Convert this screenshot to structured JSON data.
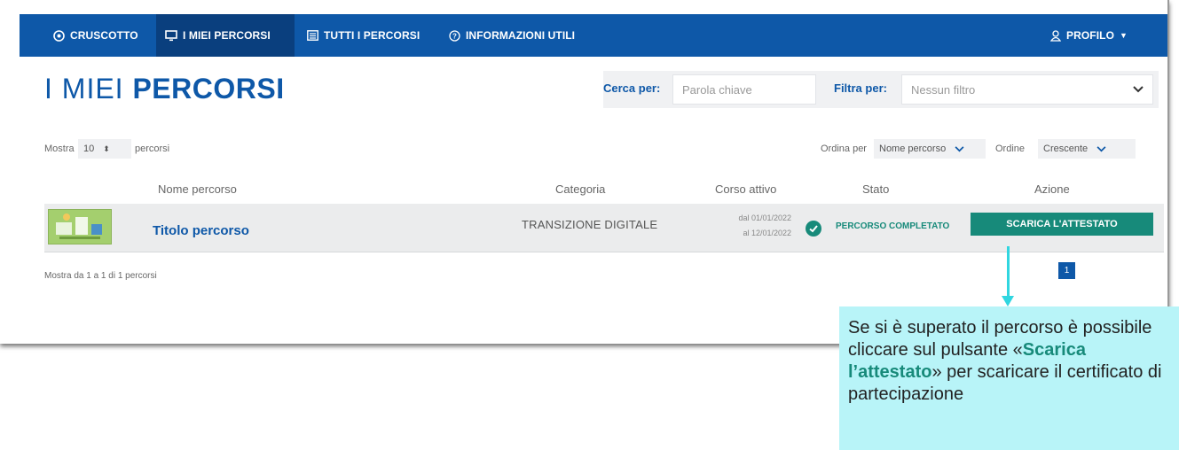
{
  "nav": {
    "items": [
      {
        "label": "CRUSCOTTO",
        "icon": "dashboard-icon"
      },
      {
        "label": "I MIEI PERCORSI",
        "icon": "monitor-icon"
      },
      {
        "label": "TUTTI I PERCORSI",
        "icon": "list-icon"
      },
      {
        "label": "INFORMAZIONI UTILI",
        "icon": "help-icon"
      }
    ],
    "profile": "PROFILO"
  },
  "page": {
    "title_light": "I MIEI ",
    "title_bold": "PERCORSI"
  },
  "search": {
    "label": "Cerca per:",
    "placeholder": "Parola chiave",
    "filter_label": "Filtra per:",
    "filter_value": "Nessun filtro"
  },
  "list_controls": {
    "show_prefix": "Mostra",
    "page_size": "10",
    "show_suffix": "percorsi",
    "sort_label": "Ordina per",
    "sort_value": "Nome percorso",
    "order_label": "Ordine",
    "order_value": "Crescente"
  },
  "table": {
    "headers": [
      "Nome percorso",
      "Categoria",
      "Corso attivo",
      "Stato",
      "Azione"
    ],
    "rows": [
      {
        "title": "Titolo percorso",
        "category": "TRANSIZIONE DIGITALE",
        "date_from": "dal 01/01/2022",
        "date_to": "al 12/01/2022",
        "status": "PERCORSO COMPLETATO",
        "action": "SCARICA L'ATTESTATO"
      }
    ]
  },
  "pagination": {
    "summary": "Mostra da 1 a 1 di 1 percorsi",
    "current_page": "1"
  },
  "callout": {
    "line1": "Se si è superato il percorso è possibile cliccare sul pulsante «",
    "highlight": "Scarica l’attestato",
    "line2": "» per scaricare il certificato di partecipazione"
  },
  "colors": {
    "primary": "#0e58a8",
    "teal": "#178a7a",
    "callout_bg": "#b8f4f8",
    "arrow": "#30d6e0"
  }
}
